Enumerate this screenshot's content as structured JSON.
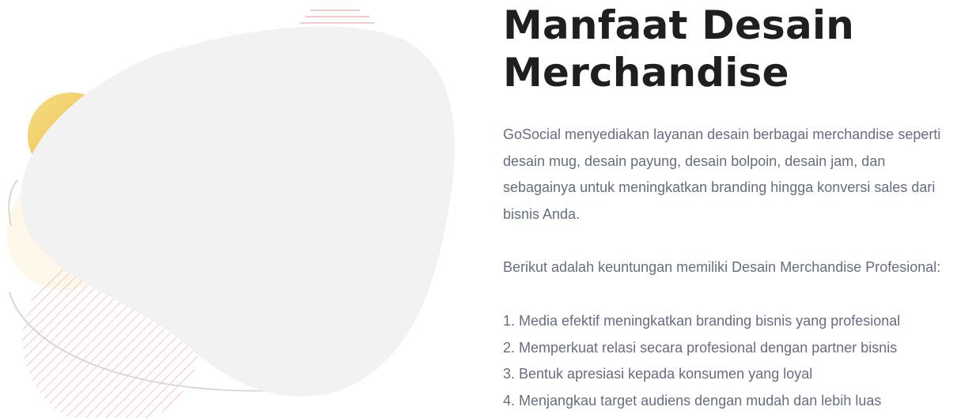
{
  "section": {
    "title_lines": [
      "Manfaat Desain",
      "Merchandise"
    ],
    "intro_lines": [
      "GoSocial menyediakan layanan desain berbagai merchandise seperti",
      "desain mug, desain payung, desain bolpoin, desain jam, dan",
      "sebagainya untuk meningkatkan branding hingga konversi sales dari",
      "bisnis Anda."
    ],
    "lead": "Berikut adalah keuntungan memiliki Desain Merchandise Profesional:",
    "benefits": [
      "1. Media efektif meningkatkan branding bisnis yang profesional",
      "2. Memperkuat relasi secara profesional dengan partner bisnis",
      "3. Bentuk apresiasi kepada konsumen yang loyal",
      "4. Menjangkau target audiens dengan mudah dan lebih luas"
    ]
  },
  "illustration": {
    "colors": {
      "blob": "#f2f2f2",
      "circle_start": "#f6dc86",
      "circle_end": "#e8bd3c",
      "stripes": "#efb8b8",
      "arc": "#cfcfcf"
    }
  }
}
